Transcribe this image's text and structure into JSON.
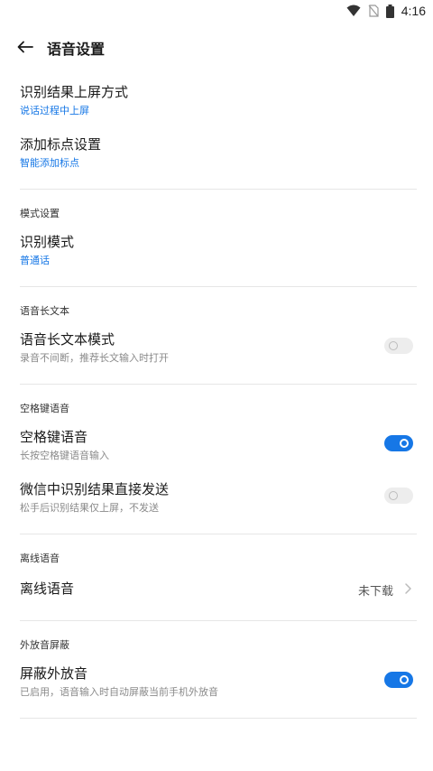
{
  "status_bar": {
    "time": "4:16"
  },
  "app_bar": {
    "title": "语音设置"
  },
  "items": {
    "screen_method": {
      "title": "识别结果上屏方式",
      "subtitle": "说话过程中上屏"
    },
    "punctuation": {
      "title": "添加标点设置",
      "subtitle": "智能添加标点"
    },
    "recognition_mode": {
      "title": "识别模式",
      "subtitle": "普通话"
    },
    "long_text_mode": {
      "title": "语音长文本模式",
      "subtitle": "录音不间断，推荐长文输入时打开",
      "enabled": false
    },
    "space_key_voice": {
      "title": "空格键语音",
      "subtitle": "长按空格键语音输入",
      "enabled": true
    },
    "wechat_send": {
      "title": "微信中识别结果直接发送",
      "subtitle": "松手后识别结果仅上屏，不发送",
      "enabled": false
    },
    "offline_voice": {
      "title": "离线语音",
      "value": "未下载"
    },
    "mask_speaker": {
      "title": "屏蔽外放音",
      "subtitle": "已启用，语音输入时自动屏蔽当前手机外放音",
      "enabled": true
    }
  },
  "sections": {
    "mode": "模式设置",
    "long_text": "语音长文本",
    "space_key": "空格键语音",
    "offline": "离线语音",
    "speaker_mask": "外放音屏蔽"
  },
  "colors": {
    "accent": "#1677e6",
    "divider": "#e6e6e6"
  }
}
